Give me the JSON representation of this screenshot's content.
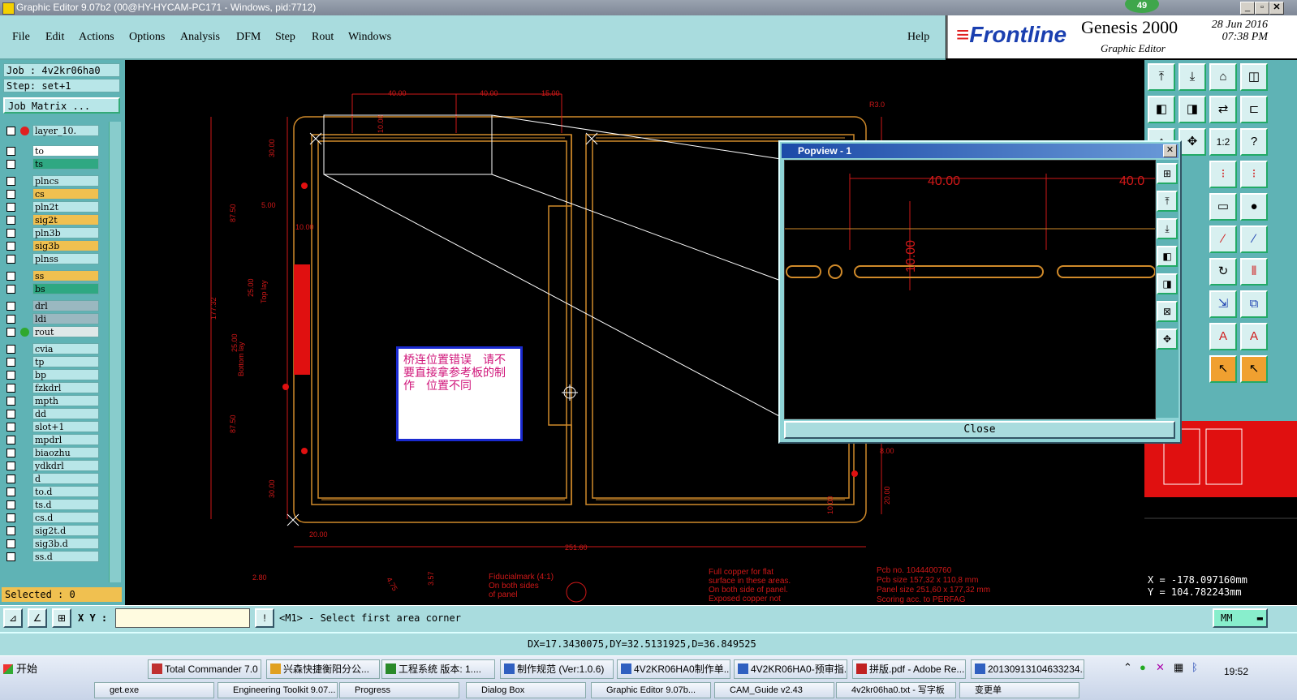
{
  "titlebar": {
    "title": "Graphic Editor 9.07b2 (00@HY-HYCAM-PC171 - Windows, pid:7712)",
    "badge": "49"
  },
  "menu": {
    "items": [
      "File",
      "Edit",
      "Actions",
      "Options",
      "Analysis",
      "DFM",
      "Step",
      "Rout",
      "Windows"
    ],
    "help": "Help"
  },
  "brand": {
    "logo_icon": "frontline-stripes-icon",
    "logo": "Frontline",
    "product": "Genesis 2000",
    "subtitle": "Graphic Editor",
    "date": "28 Jun 2016",
    "time": "07:38 PM"
  },
  "job": {
    "job_label": "Job : 4v2kr06ha0",
    "step_label": "Step: set+1",
    "matrix_button": "Job Matrix ..."
  },
  "layers": [
    {
      "name": "layer_10.",
      "color": "#b8e6e8",
      "dot": "#e02020"
    },
    {
      "name": "to",
      "color": "#ffffff"
    },
    {
      "name": "ts",
      "color": "#2fa882"
    },
    {
      "name": "plncs",
      "color": "#b8e6e8"
    },
    {
      "name": "cs",
      "color": "#f0c050"
    },
    {
      "name": "pln2t",
      "color": "#b8e6e8"
    },
    {
      "name": "sig2t",
      "color": "#f0c050"
    },
    {
      "name": "pln3b",
      "color": "#b8e6e8"
    },
    {
      "name": "sig3b",
      "color": "#f0c050"
    },
    {
      "name": "plnss",
      "color": "#b8e6e8"
    },
    {
      "name": "ss",
      "color": "#f0c050"
    },
    {
      "name": "bs",
      "color": "#2fa882"
    },
    {
      "name": "drl",
      "color": "#9ab8c0"
    },
    {
      "name": "ldi",
      "color": "#9ab8c0"
    },
    {
      "name": "rout",
      "color": "#dfe8e8",
      "dot": "#2fa82f"
    },
    {
      "name": "cvia",
      "color": "#b8e6e8"
    },
    {
      "name": "tp",
      "color": "#b8e6e8"
    },
    {
      "name": "bp",
      "color": "#b8e6e8"
    },
    {
      "name": "fzkdrl",
      "color": "#b8e6e8"
    },
    {
      "name": "mpth",
      "color": "#b8e6e8"
    },
    {
      "name": "dd",
      "color": "#b8e6e8"
    },
    {
      "name": "slot+1",
      "color": "#b8e6e8"
    },
    {
      "name": "mpdrl",
      "color": "#b8e6e8"
    },
    {
      "name": "biaozhu",
      "color": "#b8e6e8"
    },
    {
      "name": "ydkdrl",
      "color": "#b8e6e8"
    },
    {
      "name": "d",
      "color": "#b8e6e8"
    },
    {
      "name": "to.d",
      "color": "#b8e6e8"
    },
    {
      "name": "ts.d",
      "color": "#b8e6e8"
    },
    {
      "name": "cs.d",
      "color": "#b8e6e8"
    },
    {
      "name": "sig2t.d",
      "color": "#b8e6e8"
    },
    {
      "name": "sig3b.d",
      "color": "#b8e6e8"
    },
    {
      "name": "ss.d",
      "color": "#b8e6e8"
    }
  ],
  "selected": "Selected : 0",
  "canvas": {
    "dims": {
      "d40a": "40.00",
      "d40b": "40.00",
      "d15": "15.00",
      "d10a": "10.00",
      "r3": "R3.0",
      "d30a": "30.00",
      "d5": "5.00",
      "d10b": "10.00",
      "d87a": "87.50",
      "d177": "177.32",
      "d25a": "25.00",
      "d25b": "25.00",
      "d87b": "87.50",
      "d30b": "30.00",
      "d20a": "20.00",
      "d251": "251.60",
      "d8": "8.00",
      "d10c": "10.00",
      "d20b": "20.00",
      "d280": "2.80",
      "d357": "3.57",
      "d475": "4.75",
      "toplay": "Top lay",
      "bottomlay": "Bottom lay"
    },
    "notes": {
      "fid1": "Fiducialmark (4:1)",
      "fid2": "On both sides",
      "fid3": "of panel",
      "cu1": "Full copper for flat",
      "cu2": "surface in these areas.",
      "cu3": "On both side of panel.",
      "cu4": "Exposed copper not",
      "pcb1": "Pcb no. 1044400760",
      "pcb2": "Pcb size 157,32 x 110,8 mm",
      "pcb3": "Panel size 251,60 x 177,32 mm",
      "pcb4": "Scoring acc. to PERFAG"
    },
    "annotation": "桥连位置错误　请不要直接拿参考板的制作　位置不同"
  },
  "popview": {
    "title": "Popview - 1",
    "dim_h": "40.00",
    "dim_h2": "40.0",
    "dim_v": "10.00",
    "close_label": "Close"
  },
  "coords": {
    "x": "X = -178.097160mm",
    "y": "Y =  104.782243mm"
  },
  "command": {
    "xy_label": "X Y :",
    "xy_value": "",
    "prompt": "<M1> - Select first area corner",
    "units": "MM"
  },
  "status": "DX=17.3430075,DY=32.5131925,D=36.849525",
  "taskbar": {
    "start": "开始",
    "tasks": [
      "Total Commander 7.0 ...",
      "兴森快捷衡阳分公...",
      "工程系统  版本: 1....",
      "制作规范 (Ver:1.0.6)",
      "4V2KR06HA0制作单....",
      "4V2KR06HA0-预审指...",
      "拼版.pdf - Adobe Re...",
      "20130913104633234..."
    ],
    "tasks2": [
      "get.exe",
      "Engineering Toolkit 9.07...",
      "Progress",
      "Dialog Box",
      "Graphic Editor 9.07b...",
      "CAM_Guide v2.43",
      "4v2kr06ha0.txt - 写字板",
      "变更单"
    ],
    "clock": "19:52"
  },
  "colors": {
    "cyan": "#a9dcde",
    "teal": "#5fb3b5",
    "profile": "#d08a2a",
    "dim": "#d01818"
  }
}
